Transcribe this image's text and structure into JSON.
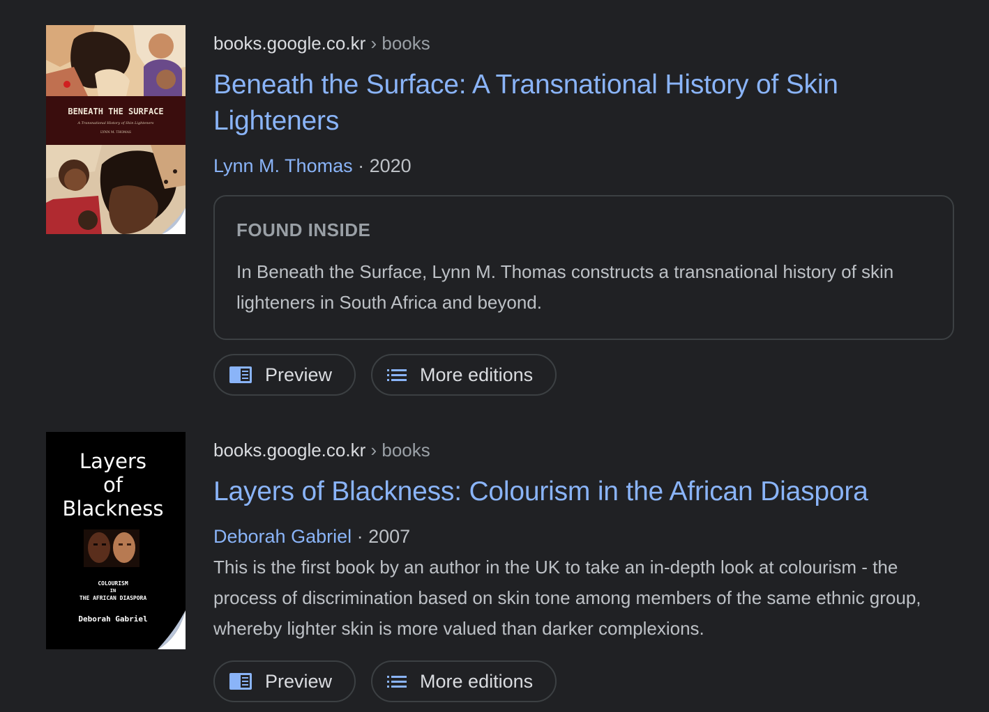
{
  "results": [
    {
      "source": {
        "site": "books.google.co.kr",
        "separator": " › ",
        "crumb": "books"
      },
      "title": "Beneath the Surface: A Transnational History of Skin Lighteners",
      "author": "Lynn M. Thomas",
      "year_sep": " · ",
      "year": "2020",
      "found_inside": {
        "heading": "FOUND INSIDE",
        "text": "In Beneath the Surface, Lynn M. Thomas constructs a transnational history of skin lighteners in South Africa and beyond."
      },
      "cover": {
        "title": "BENEATH THE SURFACE",
        "subtitle": "A Transnational History of Skin Lighteners",
        "author": "LYNN M. THOMAS"
      },
      "buttons": {
        "preview": "Preview",
        "more_editions": "More editions"
      }
    },
    {
      "source": {
        "site": "books.google.co.kr",
        "separator": " › ",
        "crumb": "books"
      },
      "title": "Layers of Blackness: Colourism in the African Diaspora",
      "author": "Deborah Gabriel",
      "year_sep": " · ",
      "year": "2007",
      "snippet": "This is the first book by an author in the UK to take an in-depth look at colourism - the process of discrimination based on skin tone among members of the same ethnic group, whereby lighter skin is more valued than darker complexions.",
      "cover": {
        "title_line1": "Layers",
        "title_line2": "of",
        "title_line3": "Blackness",
        "subtitle_line1": "COLOURISM",
        "subtitle_line2": "IN",
        "subtitle_line3": "THE AFRICAN DIASPORA",
        "author": "Deborah Gabriel"
      },
      "buttons": {
        "preview": "Preview",
        "more_editions": "More editions"
      }
    }
  ],
  "colors": {
    "background": "#202124",
    "link": "#8ab4f8",
    "text": "#bdc1c6",
    "muted": "#9aa0a6",
    "border": "#3c4043"
  },
  "icons": {
    "preview": "book-preview-icon",
    "editions": "list-icon"
  }
}
